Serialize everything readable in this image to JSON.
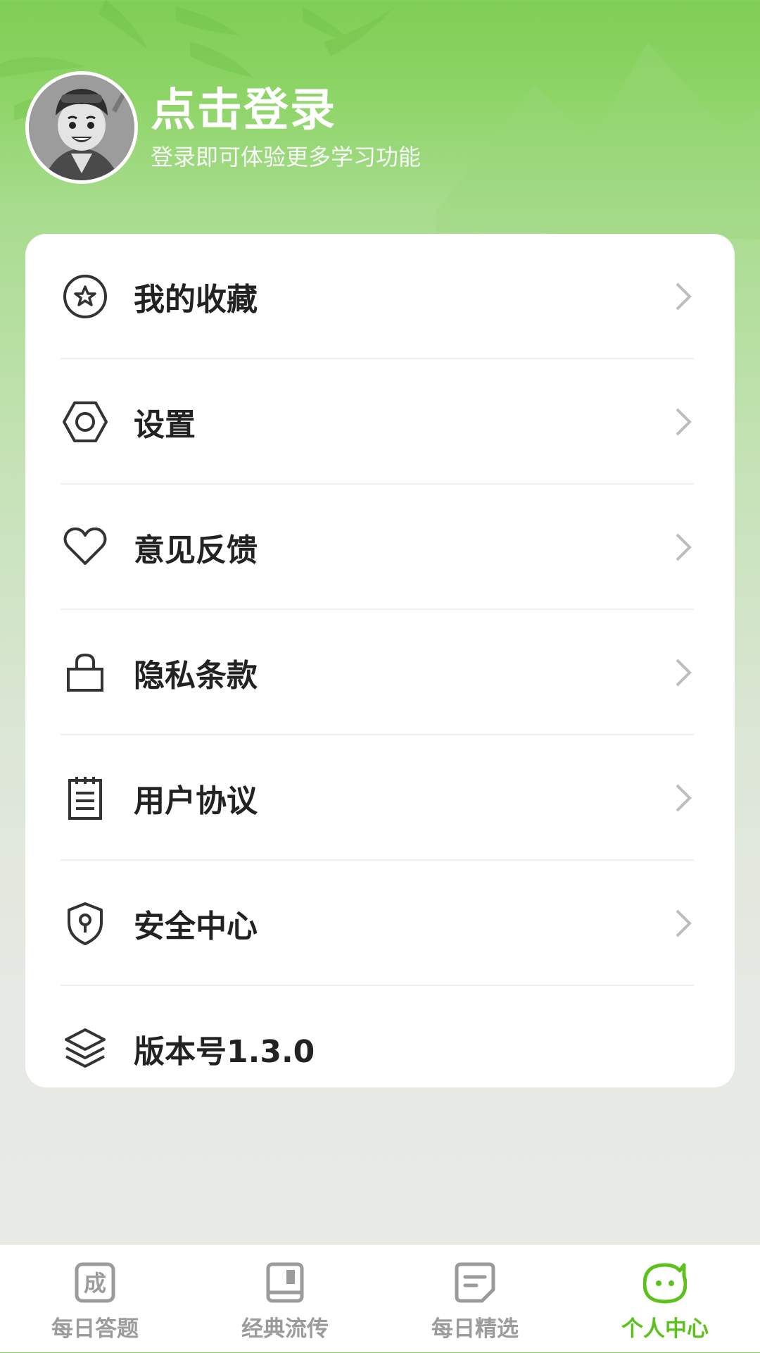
{
  "profile": {
    "title": "点击登录",
    "subtitle": "登录即可体验更多学习功能"
  },
  "menu": [
    {
      "label": "我的收藏",
      "icon": "star-circle-icon"
    },
    {
      "label": "设置",
      "icon": "hexagon-gear-icon"
    },
    {
      "label": "意见反馈",
      "icon": "heart-icon"
    },
    {
      "label": "隐私条款",
      "icon": "lock-icon"
    },
    {
      "label": "用户协议",
      "icon": "notepad-icon"
    },
    {
      "label": "安全中心",
      "icon": "shield-icon"
    },
    {
      "label": "版本号1.3.0",
      "icon": "layers-icon"
    }
  ],
  "tabs": [
    {
      "label": "每日答题",
      "icon": "idiom-cheng-icon",
      "glyph": "成"
    },
    {
      "label": "经典流传",
      "icon": "book-icon"
    },
    {
      "label": "每日精选",
      "icon": "document-icon"
    },
    {
      "label": "个人中心",
      "icon": "smiley-icon",
      "active": true
    }
  ],
  "colors": {
    "accent": "#5bc21b",
    "inactive_tab": "#9b9b9b",
    "header_green": "#7fce55"
  }
}
